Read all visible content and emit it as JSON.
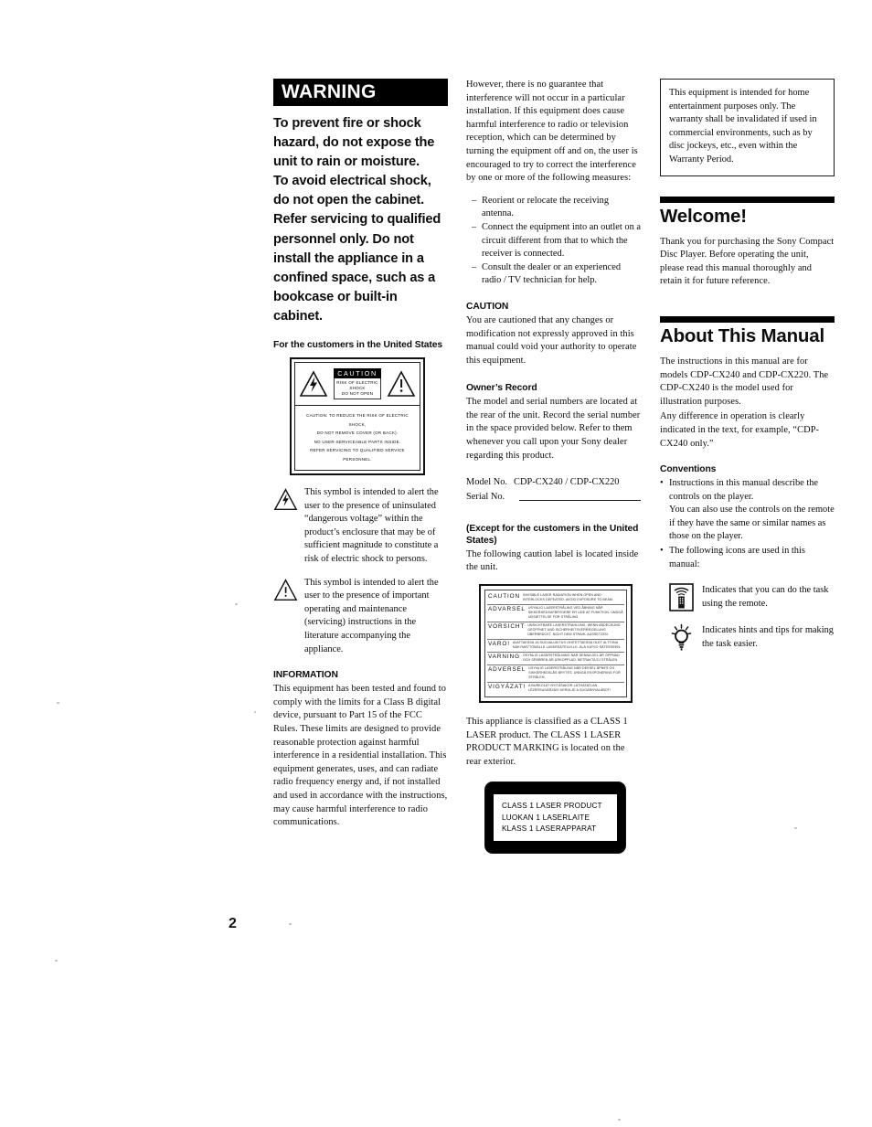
{
  "page": {
    "number": "2"
  },
  "warning": {
    "heading": "WARNING",
    "lines": [
      "To prevent fire or shock hazard, do not expose the unit to rain or moisture.",
      "To avoid electrical shock, do not open the cabinet. Refer servicing to qualified personnel only. Do not install the appliance in a confined space, such as a bookcase or built-in cabinet."
    ]
  },
  "us_customers": {
    "heading": "For the customers in the United States",
    "label": {
      "caution_word": "CAUTION",
      "risk_line_1": "RISK OF ELECTRIC SHOCK",
      "risk_line_2": "DO NOT OPEN",
      "bottom_lines": [
        "CAUTION: TO REDUCE THE RISK OF ELECTRIC SHOCK,",
        "DO NOT REMOVE COVER (OR BACK).",
        "NO USER-SERVICEABLE PARTS INSIDE.",
        "REFER SERVICING TO QUALIFIED SERVICE PERSONNEL."
      ]
    }
  },
  "symbols": [
    {
      "icon": "lightning-bolt-triangle-icon",
      "text": "This symbol is intended to alert the user to the presence of uninsulated “dangerous voltage” within the product’s enclosure that may be of sufficient magnitude to constitute a risk of electric shock to persons."
    },
    {
      "icon": "exclamation-triangle-icon",
      "text": "This symbol is intended to alert the user to the presence of important operating and maintenance (servicing) instructions in the literature accompanying the appliance."
    }
  ],
  "information": {
    "heading": "INFORMATION",
    "paragraph_1": "This equipment has been tested and found to comply with the limits for a Class B digital device, pursuant to Part 15 of the FCC Rules. These limits are designed to provide reasonable protection against harmful interference in a residential installation. This equipment generates, uses, and can radiate radio frequency energy and, if not installed and used in accordance with the instructions, may cause harmful interference to radio communications.",
    "paragraph_2": "However, there is no guarantee that interference will not occur in a particular installation. If this equipment does cause harmful interference to radio or television reception, which can be determined by turning the equipment off and on, the user is encouraged to try to correct the interference by one or more of the following measures:",
    "measures": [
      "Reorient or relocate the receiving antenna.",
      "Connect the equipment into an outlet on a circuit different from that to which the receiver is connected.",
      "Consult the dealer or an experienced radio / TV technician for help."
    ],
    "dash": "–"
  },
  "caution": {
    "heading": "CAUTION",
    "text": "You are cautioned that any changes or modification not expressly approved in this manual could void your authority to operate this equipment."
  },
  "owners_record": {
    "heading": "Owner’s Record",
    "text": "The model and serial numbers are located at the rear of the unit. Record the serial number in the space provided below. Refer to them whenever you call upon your Sony dealer regarding this product.",
    "model_label": "Model No.",
    "model_value": "CDP-CX240 / CDP-CX220",
    "serial_label": "Serial No.",
    "serial_value": ""
  },
  "except_us": {
    "heading": "(Except for the customers in the United States)",
    "text": "The following caution label is located inside the unit.",
    "laser_label": [
      {
        "lang": "CAUTION",
        "text": "INVISIBLE LASER RADIATION WHEN OPEN AND INTERLOCKS DEFEATED. AVOID EXPOSURE TO BEAM."
      },
      {
        "lang": "ADVARSEL",
        "text": "USYNLIG LASERSTRÅLING VED ÅBNING NÅR SIKKERHEDSAFBRYDERE ER UDE AF FUNKTION. UNDGÅ UDSÆTTELSE FOR STRÅLING."
      },
      {
        "lang": "VORSICHT",
        "text": "UNSICHTBARE LASERSTRAHLUNG, WENN ABDECKUNG GEÖFFNET UND SICHERHEITSVERRIEGELUNG ÜBERBRÜCKT. NICHT DEM STRAHL AUSSETZEN."
      },
      {
        "lang": "VARO!",
        "text": "AVATTAESSA JA SUOJALUKITUS OHITETTAESSA OLET ALTTIINA NÄKYMÄTTÖMÄLLE LASERSÄTEILYLLE. ÄLÄ KATSO SÄTEESEEN."
      },
      {
        "lang": "VARNING",
        "text": "OSYNLIG LASERSTRÅLNING NÄR DENNA DEL ÄR ÖPPNAD OCH SPÄRREN ÄR URKOPPLAD. BETRAKTA EJ STRÅLEN."
      },
      {
        "lang": "ADVERSEL",
        "text": "USYNLIG LASERSTRÅLING NÅR DEKSEL ÅPNES OG SIKKERHEDSLÅS BRYTES. UNNGÅ EKSPONERING FOR STRÅLEN."
      },
      {
        "lang": "VIGYÁZAT!",
        "text": "A BURKOLAT NYITÁSAKOR LÁTHATATLAN LÉZERSUGÁRZÁS! KERÜLJE A SUGÁRNYALÁBOT!"
      }
    ],
    "class1_text": "This appliance is classified as a CLASS 1 LASER product. The CLASS 1 LASER PRODUCT MARKING is located on the rear exterior.",
    "class1_box_lines": [
      "CLASS 1 LASER PRODUCT",
      "LUOKAN 1 LASERLAITE",
      "KLASS 1 LASERAPPARAT"
    ]
  },
  "home_use_note": "This equipment is intended for home entertainment purposes only. The warranty shall be invalidated if used in commercial environments, such as by disc jockeys, etc., even within the Warranty Period.",
  "welcome": {
    "title": "Welcome!",
    "text": "Thank you for purchasing the Sony Compact Disc Player. Before operating the unit, please read this manual thoroughly and retain it for future reference."
  },
  "about_manual": {
    "title": "About This Manual",
    "paragraph_1": "The instructions in this manual are for models CDP-CX240 and CDP-CX220. The CDP-CX240 is the model used for illustration purposes.",
    "paragraph_2": "Any difference in operation is clearly indicated in the text, for example, “CDP-CX240 only.”",
    "conventions_heading": "Conventions",
    "bullet": "•",
    "bullets": [
      "Instructions in this manual describe the controls on the player.\nYou can also use the controls on the remote if they have the same or similar names as those on the player.",
      "The following icons are used in this manual:"
    ],
    "icons": [
      {
        "icon": "remote-control-icon",
        "text": "Indicates that you can do the task using the remote."
      },
      {
        "icon": "lightbulb-tip-icon",
        "text": "Indicates hints and tips for making the task easier."
      }
    ]
  }
}
